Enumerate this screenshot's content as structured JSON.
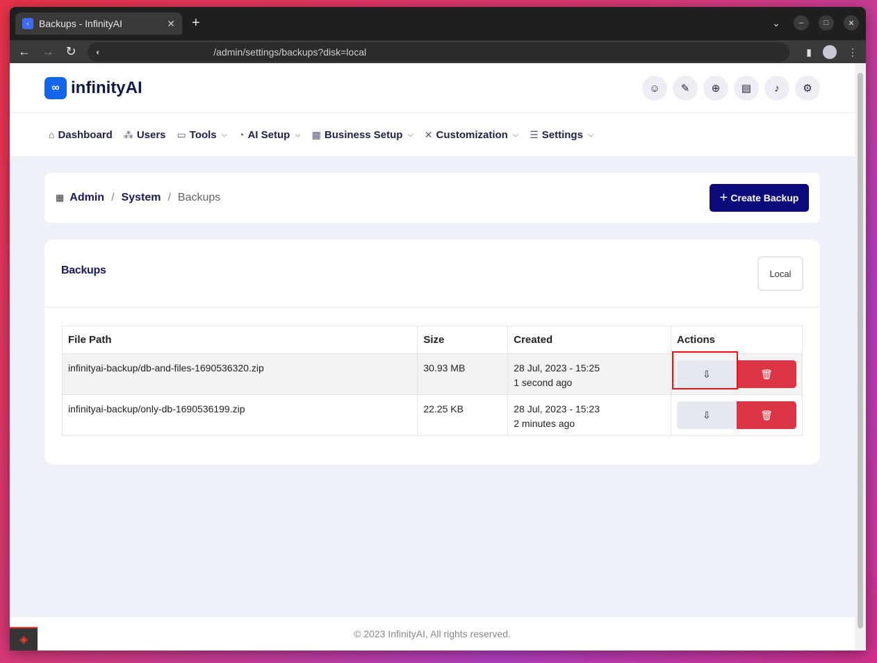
{
  "browser": {
    "tab_title": "Backups - InfinityAI",
    "url": "/admin/settings/backups?disk=local"
  },
  "header": {
    "logo_mark": "∞",
    "logo_text": "infinityAI"
  },
  "menu": [
    {
      "label": "Dashboard",
      "icon": "home-icon"
    },
    {
      "label": "Users",
      "icon": "users-icon"
    },
    {
      "label": "Tools",
      "icon": "briefcase-icon",
      "dropdown": true
    },
    {
      "label": "AI Setup",
      "icon": "gauge-icon",
      "dropdown": true
    },
    {
      "label": "Business Setup",
      "icon": "building-icon",
      "dropdown": true
    },
    {
      "label": "Customization",
      "icon": "tools-icon",
      "dropdown": true
    },
    {
      "label": "Settings",
      "icon": "sliders-icon",
      "dropdown": true
    }
  ],
  "breadcrumb": {
    "admin": "Admin",
    "system": "System",
    "current": "Backups",
    "sep": "/"
  },
  "create_button": "Create Backup",
  "card": {
    "title": "Backups",
    "disk_select": "Local"
  },
  "table": {
    "headers": [
      "File Path",
      "Size",
      "Created",
      "Actions"
    ],
    "rows": [
      {
        "path": "infinityai-backup/db-and-files-1690536320.zip",
        "size": "30.93 MB",
        "date": "28 Jul, 2023 - 15:25",
        "ago": "1 second ago"
      },
      {
        "path": "infinityai-backup/only-db-1690536199.zip",
        "size": "22.25 KB",
        "date": "28 Jul, 2023 - 15:23",
        "ago": "2 minutes ago"
      }
    ]
  },
  "footer": "© 2023 InfinityAI, All rights reserved."
}
